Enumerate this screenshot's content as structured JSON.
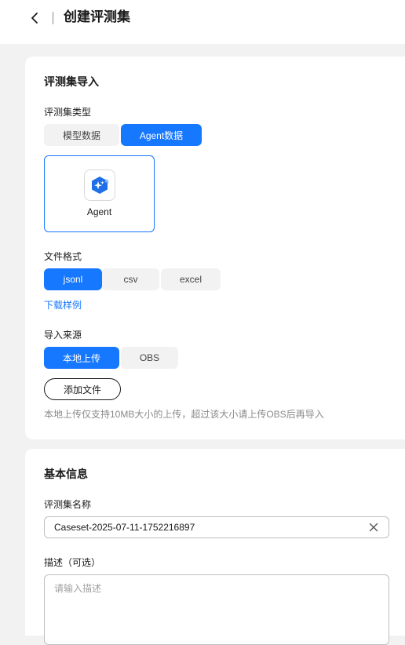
{
  "header": {
    "title": "创建评测集"
  },
  "import_section": {
    "title": "评测集导入",
    "type_label": "评测集类型",
    "type_options": [
      "模型数据",
      "Agent数据"
    ],
    "type_selected": "Agent数据",
    "agent_card_label": "Agent",
    "format_label": "文件格式",
    "format_options": [
      "jsonl",
      "csv",
      "excel"
    ],
    "format_selected": "jsonl",
    "download_sample_link": "下载样例",
    "source_label": "导入来源",
    "source_options": [
      "本地上传",
      "OBS"
    ],
    "source_selected": "本地上传",
    "add_file_button": "添加文件",
    "upload_hint": "本地上传仅支持10MB大小的上传，超过该大小请上传OBS后再导入"
  },
  "basic_info": {
    "title": "基本信息",
    "name_label": "评测集名称",
    "name_value": "Caseset-2025-07-11-1752216897",
    "desc_label": "描述（可选）",
    "desc_placeholder": "请输入描述"
  },
  "colors": {
    "accent": "#1677ff",
    "page_bg": "#f2f2f2"
  }
}
